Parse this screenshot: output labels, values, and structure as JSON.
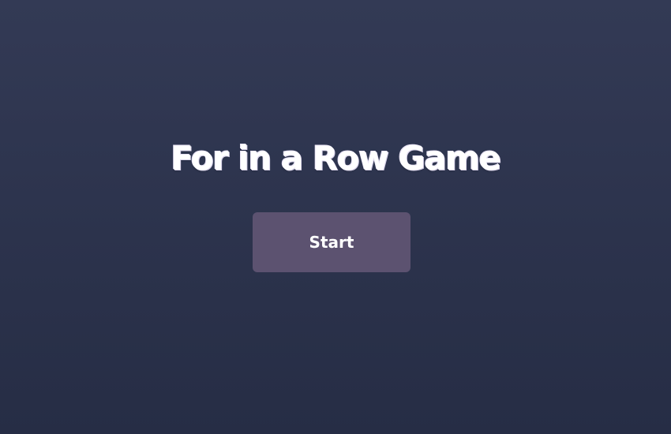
{
  "game": {
    "title": "For in a Row Game",
    "start_label": "Start"
  },
  "colors": {
    "background_top": "#333a55",
    "background_bottom": "#262d45",
    "button_bg": "#5c5270",
    "text": "#ffffff"
  }
}
